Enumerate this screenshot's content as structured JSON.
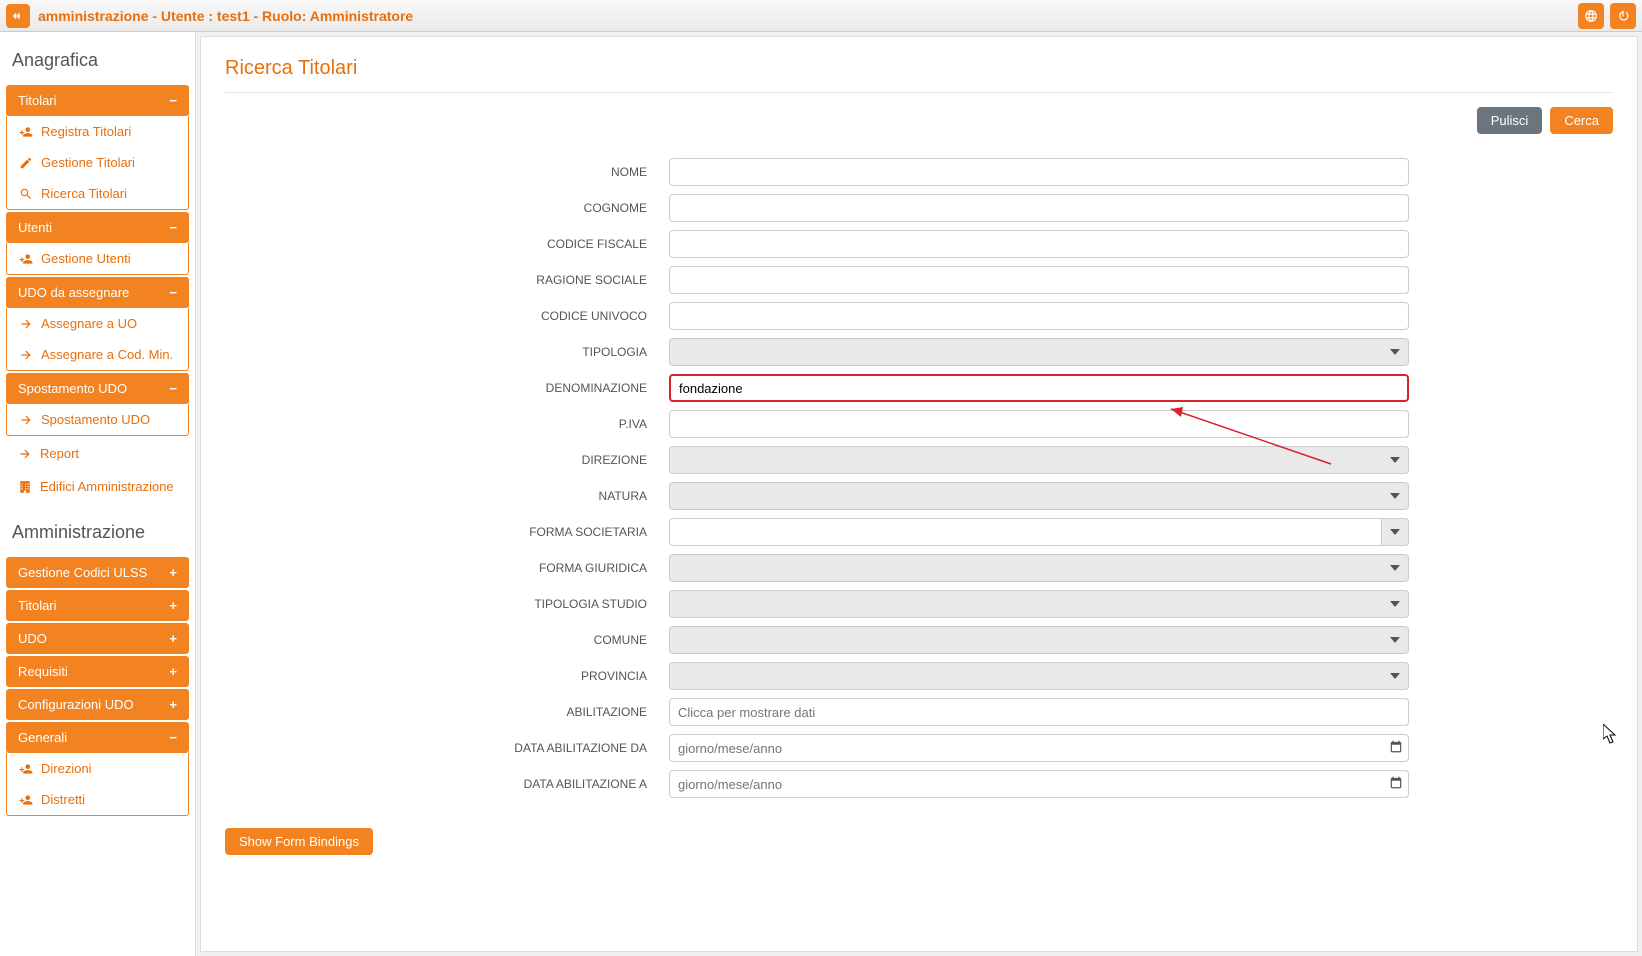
{
  "header": {
    "title": "amministrazione - Utente : test1 - Ruolo: Amministratore"
  },
  "sidebar": {
    "section_anagrafica": "Anagrafica",
    "section_amministrazione": "Amministrazione",
    "titolari": {
      "label": "Titolari",
      "registra": "Registra Titolari",
      "gestione": "Gestione Titolari",
      "ricerca": "Ricerca Titolari"
    },
    "utenti": {
      "label": "Utenti",
      "gestione": "Gestione Utenti"
    },
    "udo_assegnare": {
      "label": "UDO da assegnare",
      "uo": "Assegnare a UO",
      "cod": "Assegnare a Cod. Min."
    },
    "spostamento": {
      "label": "Spostamento UDO",
      "item": "Spostamento UDO"
    },
    "report": "Report",
    "edifici": "Edifici Amministrazione",
    "gestione_codici": "Gestione Codici ULSS",
    "titolari2": "Titolari",
    "udo": "UDO",
    "requisiti": "Requisiti",
    "config_udo": "Configurazioni UDO",
    "generali": {
      "label": "Generali",
      "direzioni": "Direzioni",
      "distretti": "Distretti"
    }
  },
  "page": {
    "title": "Ricerca Titolari",
    "pulisci": "Pulisci",
    "cerca": "Cerca",
    "show_bindings": "Show Form Bindings"
  },
  "form": {
    "nome_label": "NOME",
    "cognome_label": "COGNOME",
    "cf_label": "CODICE FISCALE",
    "ragione_label": "RAGIONE SOCIALE",
    "univoco_label": "CODICE UNIVOCO",
    "tipologia_label": "TIPOLOGIA",
    "denominazione_label": "DENOMINAZIONE",
    "denominazione_value": "fondazione",
    "piva_label": "P.IVA",
    "direzione_label": "DIREZIONE",
    "natura_label": "NATURA",
    "forma_soc_label": "FORMA SOCIETARIA",
    "forma_giu_label": "FORMA GIURIDICA",
    "tipologia_studio_label": "TIPOLOGIA STUDIO",
    "comune_label": "COMUNE",
    "provincia_label": "PROVINCIA",
    "abilitazione_label": "ABILITAZIONE",
    "abilitazione_placeholder": "Clicca per mostrare dati",
    "data_da_label": "DATA ABILITAZIONE DA",
    "data_a_label": "DATA ABILITAZIONE A",
    "date_placeholder": "giorno/mese/anno"
  }
}
